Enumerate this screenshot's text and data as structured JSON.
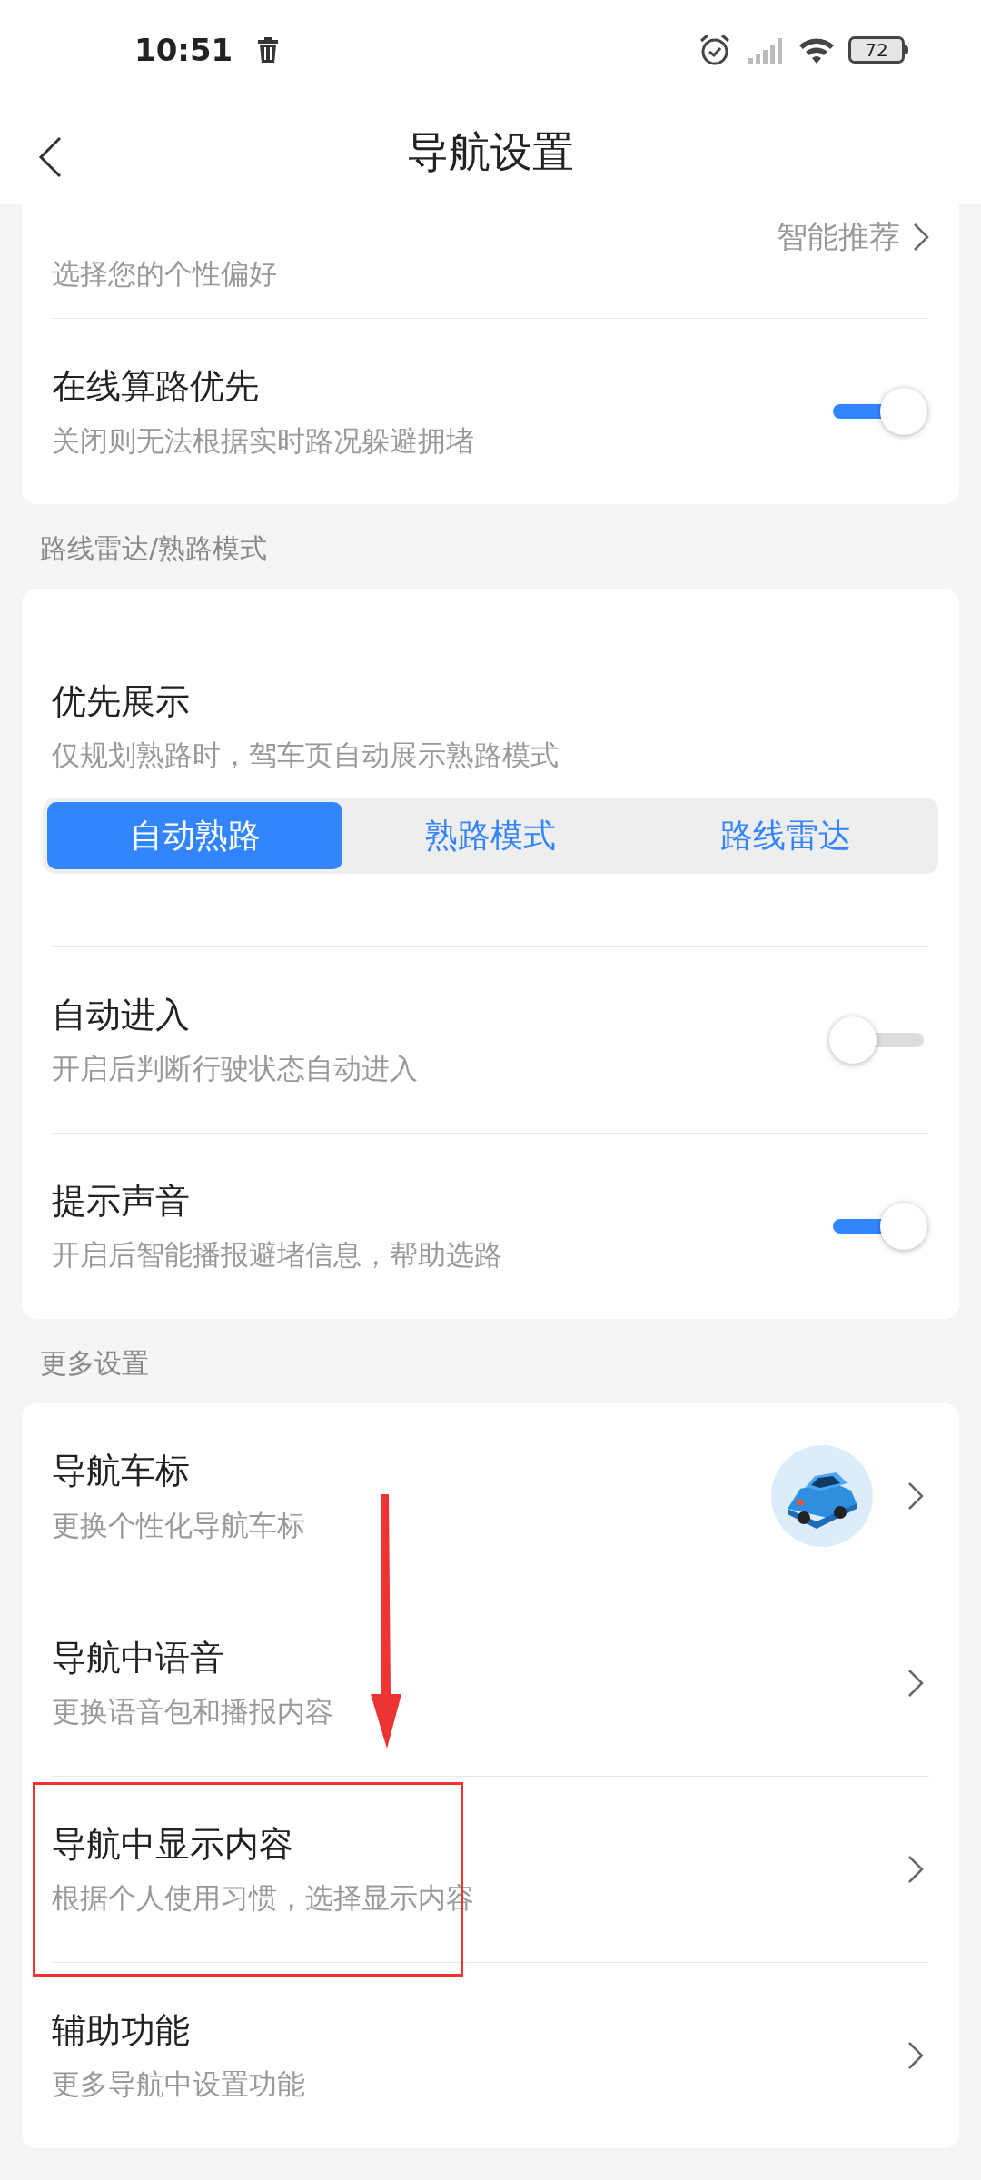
{
  "status_bar": {
    "time": "10:51",
    "battery": "72"
  },
  "header": {
    "title": "导航设置"
  },
  "groups": [
    {
      "items": [
        {
          "kind": "value",
          "subtitle": "选择您的个性偏好",
          "value": "智能推荐"
        },
        {
          "kind": "toggle",
          "title": "在线算路优先",
          "subtitle": "关闭则无法根据实时路况躲避拥堵",
          "on": true
        }
      ]
    },
    {
      "header": "路线雷达/熟路模式",
      "items": [
        {
          "kind": "segmented",
          "title": "优先展示",
          "subtitle": "仅规划熟路时，驾车页自动展示熟路模式",
          "options": [
            {
              "label": "自动熟路",
              "selected": true
            },
            {
              "label": "熟路模式",
              "selected": false
            },
            {
              "label": "路线雷达",
              "selected": false
            }
          ]
        },
        {
          "kind": "toggle",
          "title": "自动进入",
          "subtitle": "开启后判断行驶状态自动进入",
          "on": false
        },
        {
          "kind": "toggle",
          "title": "提示声音",
          "subtitle": "开启后智能播报避堵信息，帮助选路",
          "on": true
        }
      ]
    },
    {
      "header": "更多设置",
      "items": [
        {
          "kind": "car_link",
          "title": "导航车标",
          "subtitle": "更换个性化导航车标"
        },
        {
          "kind": "link",
          "title": "导航中语音",
          "subtitle": "更换语音包和播报内容"
        },
        {
          "kind": "link",
          "title": "导航中显示内容",
          "subtitle": "根据个人使用习惯，选择显示内容"
        },
        {
          "kind": "link",
          "title": "辅助功能",
          "subtitle": "更多导航中设置功能"
        }
      ]
    }
  ]
}
